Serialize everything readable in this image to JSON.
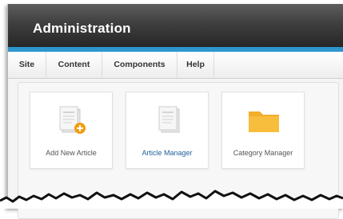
{
  "header": {
    "title": "Administration"
  },
  "menu": {
    "items": [
      {
        "label": "Site"
      },
      {
        "label": "Content"
      },
      {
        "label": "Components"
      },
      {
        "label": "Help"
      }
    ]
  },
  "quick_icons": [
    {
      "label": "Add New Article",
      "icon": "article-add-icon"
    },
    {
      "label": "Article Manager",
      "icon": "article-icon"
    },
    {
      "label": "Category Manager",
      "icon": "folder-icon"
    }
  ],
  "colors": {
    "header": "#2e2e2e",
    "accent": "#2e96cf",
    "badge": "#f39c12",
    "folder": "#f7bd3d",
    "link": "#1f5f9a"
  }
}
